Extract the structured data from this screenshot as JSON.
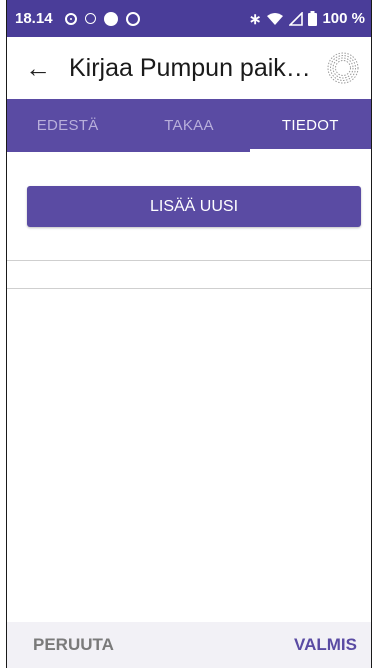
{
  "statusbar": {
    "time": "18.14",
    "bluetooth_glyph": "∗",
    "battery_text": "100 %",
    "icons_left": [
      "ring-dot-icon",
      "info-circle-icon",
      "filled-circle-icon",
      "swirl-icon"
    ],
    "icons_right": [
      "bluetooth-icon",
      "wifi-icon",
      "signal-icon",
      "battery-icon"
    ]
  },
  "appbar": {
    "back_glyph": "←",
    "title": "Kirjaa Pumpun paik…"
  },
  "tabs": [
    {
      "label": "EDESTÄ",
      "active": false
    },
    {
      "label": "TAKAA",
      "active": false
    },
    {
      "label": "TIEDOT",
      "active": true
    }
  ],
  "main": {
    "add_button_label": "LISÄÄ UUSI"
  },
  "bottom": {
    "cancel_label": "PERUUTA",
    "done_label": "VALMIS"
  },
  "colors": {
    "statusbar": "#4a3d99",
    "tabs": "#5a4ba3",
    "accent": "#5a4ba3",
    "bottombar": "#f2f1f6"
  }
}
